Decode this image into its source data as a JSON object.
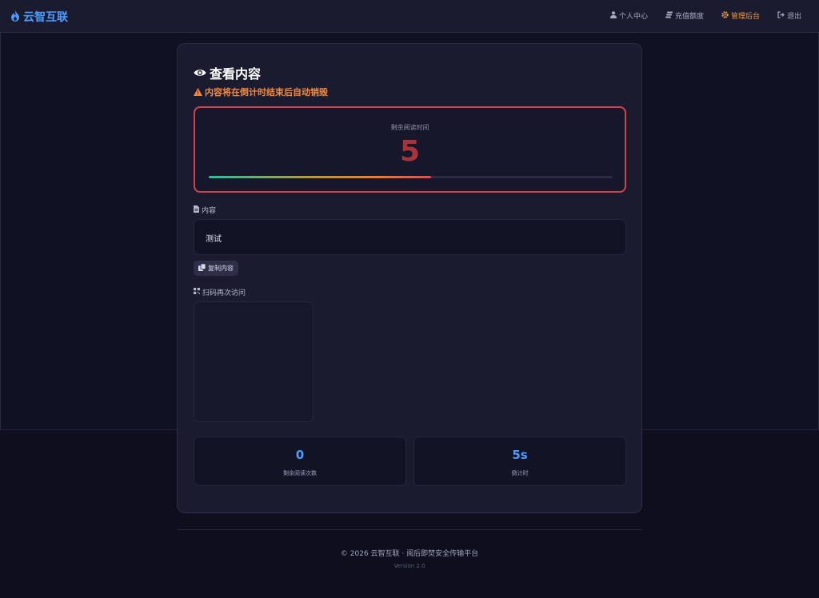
{
  "brand": {
    "name": "云智互联"
  },
  "nav": {
    "items": [
      {
        "label": "个人中心",
        "icon": "user-icon"
      },
      {
        "label": "充值额度",
        "icon": "coins-icon"
      },
      {
        "label": "管理后台",
        "icon": "gear-icon",
        "active": true
      },
      {
        "label": "退出",
        "icon": "sign-out-icon"
      }
    ]
  },
  "page": {
    "title": "查看内容",
    "warning": "内容将在倒计时结束后自动销毁"
  },
  "timer": {
    "label": "剩余阅读时间",
    "value": "5",
    "progress_percent": 55
  },
  "content": {
    "label": "内容",
    "text": "测试",
    "copy_label": "复制内容"
  },
  "qr": {
    "label": "扫码再次访问"
  },
  "stats": [
    {
      "value": "0",
      "label": "剩余阅读次数"
    },
    {
      "value": "5s",
      "label": "倒计时"
    }
  ],
  "footer": {
    "text": "© 2026 云智互联 · 阅后即焚安全传输平台",
    "version": "Version 2.0"
  },
  "colors": {
    "accent": "#4e9bff",
    "warning": "#f28a3c",
    "danger": "#d2434b"
  }
}
